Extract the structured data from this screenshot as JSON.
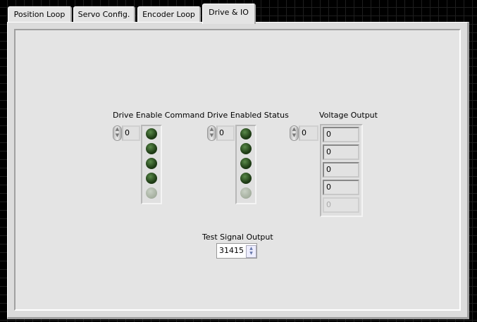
{
  "tabs": [
    {
      "label": "Position Loop"
    },
    {
      "label": "Servo Config."
    },
    {
      "label": "Encoder Loop"
    },
    {
      "label": "Drive & IO",
      "selected": true
    }
  ],
  "drive_enable_command": {
    "label": "Drive Enable Command",
    "index": "0",
    "leds": [
      true,
      true,
      true,
      true,
      false
    ]
  },
  "drive_enabled_status": {
    "label": "Drive Enabled Status",
    "index": "0",
    "leds": [
      true,
      true,
      true,
      true,
      false
    ]
  },
  "voltage_output": {
    "label": "Voltage Output",
    "index": "0",
    "values": [
      "0",
      "0",
      "0",
      "0",
      "0"
    ]
  },
  "test_signal_output": {
    "label": "Test Signal Output",
    "value": "31415"
  },
  "colors": {
    "led_on": "#1f3d16",
    "led_off": "#a4ae9e",
    "panel": "#e4e4e4"
  }
}
